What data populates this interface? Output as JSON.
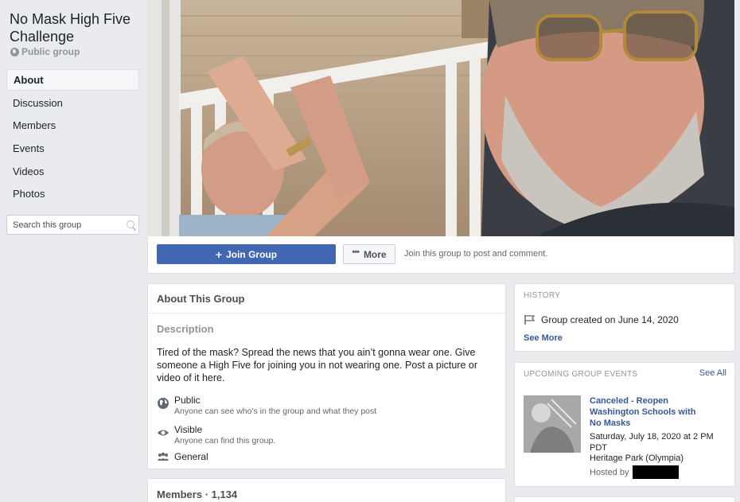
{
  "group": {
    "name": "No Mask High Five Challenge",
    "privacy_label": "Public group"
  },
  "sidebar": {
    "items": [
      {
        "label": "About"
      },
      {
        "label": "Discussion"
      },
      {
        "label": "Members"
      },
      {
        "label": "Events"
      },
      {
        "label": "Videos"
      },
      {
        "label": "Photos"
      }
    ],
    "search_placeholder": "Search this group"
  },
  "cover_actions": {
    "join_label": "Join Group",
    "more_label": "More",
    "hint": "Join this group to post and comment."
  },
  "about": {
    "header": "About This Group",
    "description_label": "Description",
    "description": "Tired of the mask?  Spread the news that you ain’t gonna wear one. Give someone a High Five for joining you in not wearing one. Post a picture or video of it here.",
    "public_title": "Public",
    "public_sub": "Anyone can see who's in the group and what they post",
    "visible_title": "Visible",
    "visible_sub": "Anyone can find this group.",
    "category": "General"
  },
  "members": {
    "title": "Members · 1,134"
  },
  "history": {
    "header": "HISTORY",
    "created": "Group created on June 14, 2020",
    "see_more": "See More"
  },
  "events": {
    "header": "UPCOMING GROUP EVENTS",
    "see_all": "See All",
    "title": "Canceled - Reopen Washington Schools with No Masks",
    "when": "Saturday, July 18, 2020 at 2 PM PDT",
    "where": "Heritage Park (Olympia)",
    "hosted_by_label": "Hosted by"
  },
  "colors": {
    "brand_blue": "#4267b2",
    "link_blue": "#365899",
    "page_bg": "#e9ebee"
  }
}
